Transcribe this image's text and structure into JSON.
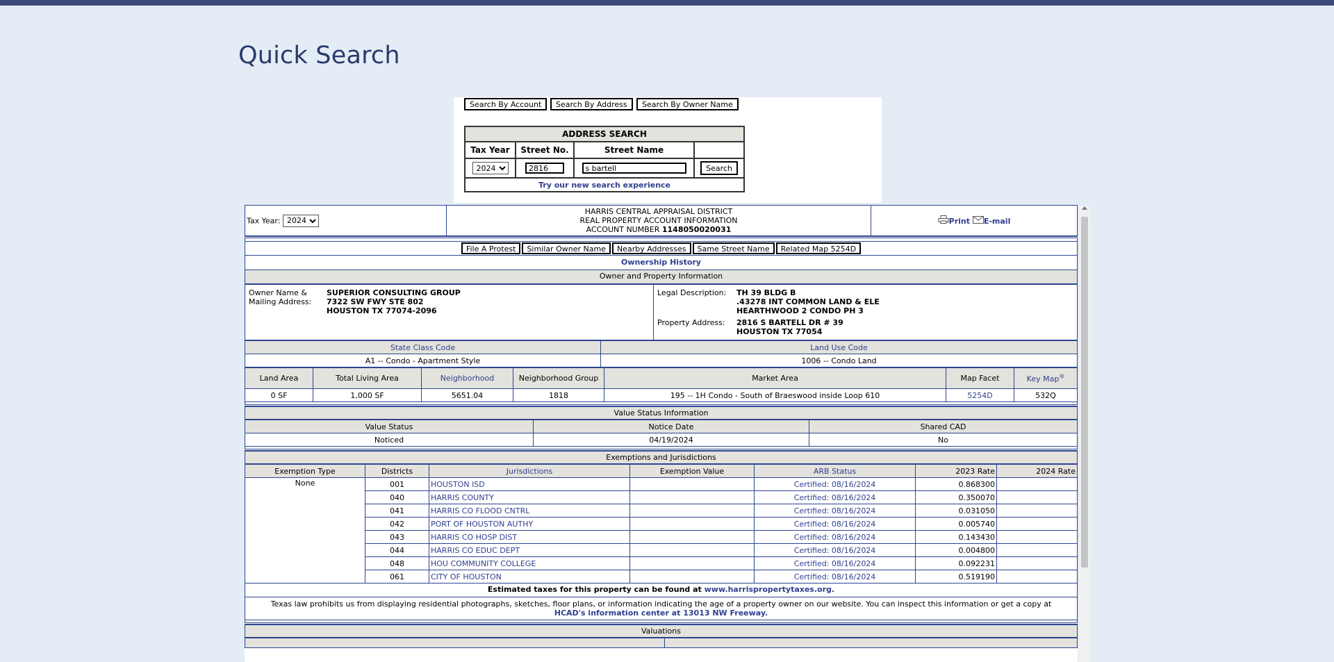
{
  "page_title": "Quick Search",
  "search_tabs": [
    "Search By Account",
    "Search By Address",
    "Search By Owner Name"
  ],
  "address_search": {
    "title": "ADDRESS SEARCH",
    "col_tax_year": "Tax Year",
    "col_street_no": "Street No.",
    "col_street_name": "Street Name",
    "tax_year": "2024",
    "street_no": "2816",
    "street_name": "s bartell",
    "search_button": "Search",
    "new_experience_link": "Try our new search experience"
  },
  "header": {
    "tax_year_label": "Tax Year:",
    "tax_year": "2024",
    "line1": "HARRIS CENTRAL APPRAISAL DISTRICT",
    "line2": "REAL PROPERTY ACCOUNT INFORMATION",
    "account_label": "ACCOUNT NUMBER",
    "account_number": "1148050020031",
    "print": "Print",
    "email": "E-mail"
  },
  "actions": [
    "File A Protest",
    "Similar Owner Name",
    "Nearby Addresses",
    "Same Street Name",
    "Related Map 5254D"
  ],
  "ownership_history": "Ownership History",
  "owner_section": {
    "title": "Owner and Property Information",
    "owner_label_1": "Owner Name &",
    "owner_label_2": "Mailing Address:",
    "owner_lines": [
      "SUPERIOR CONSULTING GROUP",
      "7322 SW FWY STE 802",
      "HOUSTON TX 77074-2096"
    ],
    "legal_label": "Legal Description:",
    "legal_lines": [
      "TH 39 BLDG B",
      ".43278 INT COMMON LAND & ELE",
      "HEARTHWOOD 2 CONDO PH 3"
    ],
    "property_label": "Property Address:",
    "property_lines": [
      "2816 S BARTELL DR # 39",
      "HOUSTON TX 77054"
    ]
  },
  "class_codes": {
    "state_class_label": "State Class Code",
    "land_use_label": "Land Use Code",
    "state_class_value": "A1 -- Condo - Apartment Style",
    "land_use_value": "1006 -- Condo Land"
  },
  "land": {
    "headers": [
      "Land Area",
      "Total Living Area",
      "Neighborhood",
      "Neighborhood Group",
      "Market Area",
      "Map Facet",
      "Key Map"
    ],
    "key_map_sup": "®",
    "values": [
      "0 SF",
      "1,000 SF",
      "5651.04",
      "1818",
      "195 -- 1H Condo - South of Braeswood inside Loop 610",
      "5254D",
      "532Q"
    ]
  },
  "value_status": {
    "title": "Value Status Information",
    "headers": [
      "Value Status",
      "Notice Date",
      "Shared CAD"
    ],
    "values": [
      "Noticed",
      "04/19/2024",
      "No"
    ]
  },
  "exemptions": {
    "title": "Exemptions and Jurisdictions",
    "headers": [
      "Exemption Type",
      "Districts",
      "Jurisdictions",
      "Exemption Value",
      "ARB Status",
      "2023 Rate",
      "2024 Rate"
    ],
    "exemption_type": "None",
    "rows": [
      {
        "district": "001",
        "jurisdiction": "HOUSTON ISD",
        "arb": "Certified: 08/16/2024",
        "rate2023": "0.868300"
      },
      {
        "district": "040",
        "jurisdiction": "HARRIS COUNTY",
        "arb": "Certified: 08/16/2024",
        "rate2023": "0.350070"
      },
      {
        "district": "041",
        "jurisdiction": "HARRIS CO FLOOD CNTRL",
        "arb": "Certified: 08/16/2024",
        "rate2023": "0.031050"
      },
      {
        "district": "042",
        "jurisdiction": "PORT OF HOUSTON AUTHY",
        "arb": "Certified: 08/16/2024",
        "rate2023": "0.005740"
      },
      {
        "district": "043",
        "jurisdiction": "HARRIS CO HOSP DIST",
        "arb": "Certified: 08/16/2024",
        "rate2023": "0.143430"
      },
      {
        "district": "044",
        "jurisdiction": "HARRIS CO EDUC DEPT",
        "arb": "Certified: 08/16/2024",
        "rate2023": "0.004800"
      },
      {
        "district": "048",
        "jurisdiction": "HOU COMMUNITY COLLEGE",
        "arb": "Certified: 08/16/2024",
        "rate2023": "0.092231"
      },
      {
        "district": "061",
        "jurisdiction": "CITY OF HOUSTON",
        "arb": "Certified: 08/16/2024",
        "rate2023": "0.519190"
      }
    ]
  },
  "estimated_taxes": {
    "text": "Estimated taxes for this property can be found at",
    "link": "www.harrispropertytaxes.org."
  },
  "notice": {
    "text": "Texas law prohibits us from displaying residential photographs, sketches, floor plans, or information indicating the age of a property owner on our website. You can inspect this information or get a copy at",
    "link": "HCAD's information center at 13013 NW Freeway."
  },
  "valuations_title": "Valuations"
}
